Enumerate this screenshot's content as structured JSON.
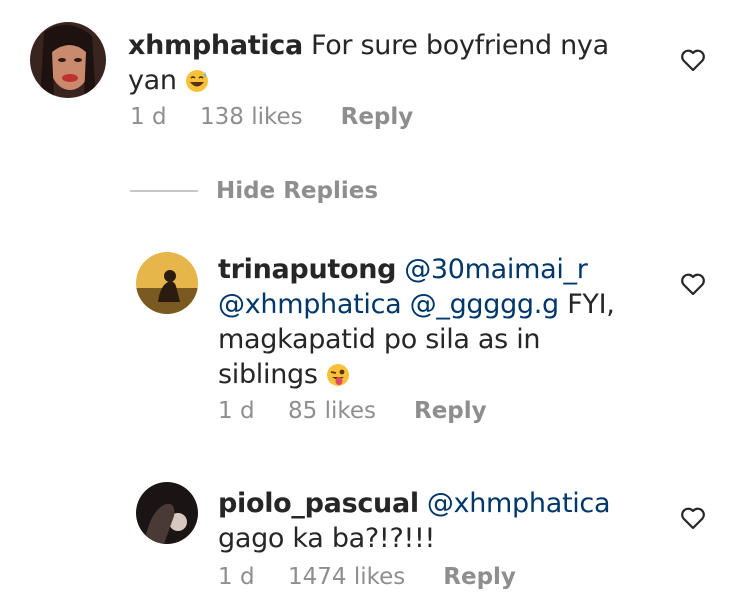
{
  "comments": [
    {
      "username": "xhmphatica",
      "text_before": "For sure boyfriend nya yan",
      "time": "1 d",
      "likes": "138 likes",
      "reply": "Reply",
      "emoji": "grinning-sweat-emoji"
    },
    {
      "username": "trinaputong",
      "mentions": [
        "@30maimai_r",
        "@xhmphatica",
        "@_ggggg.g"
      ],
      "text_before": "FYI, magkapatid po sila as in siblings",
      "time": "1 d",
      "likes": "85 likes",
      "reply": "Reply",
      "emoji": "winking-tongue-emoji"
    },
    {
      "username": "piolo_pascual",
      "mentions": [
        "@xhmphatica"
      ],
      "text_before": "gago ka ba?!?!!!",
      "time": "1 d",
      "likes": "1474 likes",
      "reply": "Reply"
    }
  ],
  "hide_replies": "Hide Replies",
  "colors": {
    "mention": "#00376b",
    "meta": "#8e8e8e",
    "text": "#262626"
  }
}
